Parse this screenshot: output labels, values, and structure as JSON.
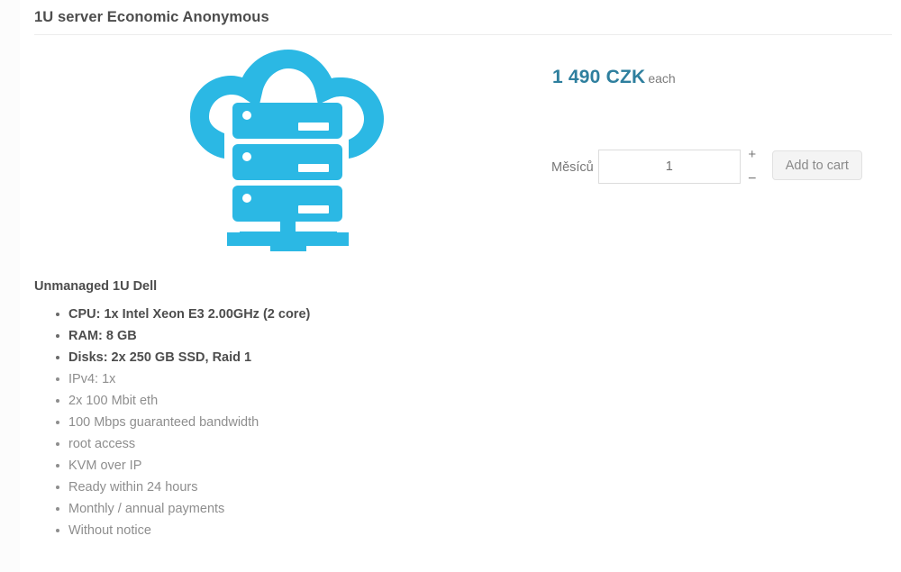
{
  "page": {
    "title": "1U server Economic Anonymous"
  },
  "product_image": {
    "alt": "cloud-server-icon",
    "color": "#2bb8e4"
  },
  "price": {
    "amount": "1 490 CZK",
    "suffix": "each",
    "color": "#2e7f9e"
  },
  "purchase": {
    "quantity_label": "Měsíců",
    "quantity_value": "1",
    "quantity_placeholder": "1",
    "increment_label": "+",
    "decrement_label": "−",
    "add_to_cart_label": "Add to cart"
  },
  "description": {
    "heading": "Unmanaged 1U Dell",
    "specs": [
      {
        "text": "CPU: 1x Intel Xeon E3 2.00GHz (2 core)",
        "emphasis": true
      },
      {
        "text": "RAM: 8 GB",
        "emphasis": true
      },
      {
        "text": "Disks: 2x 250 GB SSD, Raid 1",
        "emphasis": true
      },
      {
        "text": "IPv4: 1x",
        "emphasis": false
      },
      {
        "text": "2x 100 Mbit eth",
        "emphasis": false
      },
      {
        "text": "100 Mbps guaranteed bandwidth",
        "emphasis": false
      },
      {
        "text": "root access",
        "emphasis": false
      },
      {
        "text": "KVM over IP",
        "emphasis": false
      },
      {
        "text": "Ready within 24 hours",
        "emphasis": false
      },
      {
        "text": "Monthly / annual payments",
        "emphasis": false
      },
      {
        "text": "Without notice",
        "emphasis": false
      }
    ]
  }
}
